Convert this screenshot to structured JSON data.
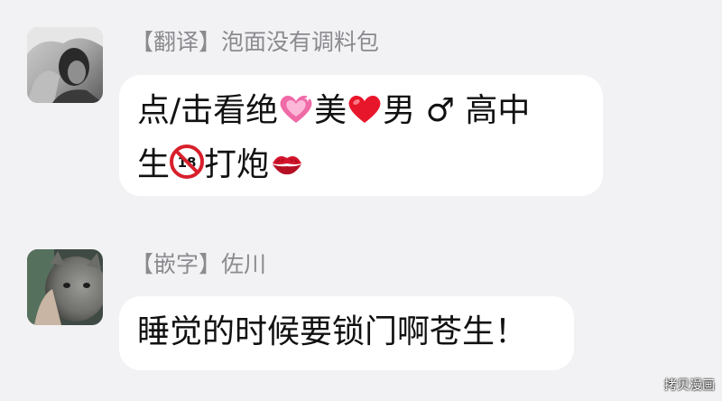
{
  "messages": [
    {
      "sender": "【翻译】泡面没有调料包",
      "text": {
        "line1_a": "点/击看绝",
        "line1_b": "美",
        "line1_c": "男",
        "line1_d": "♂ 高中",
        "line2_a": "生",
        "line2_b": "打炮"
      }
    },
    {
      "sender": "【嵌字】佐川",
      "text": "睡觉的时候要锁门啊苍生！"
    }
  ],
  "icons": {
    "emoji_1": "sparkling-heart-icon",
    "emoji_2": "red-heart-icon",
    "emoji_3": "no-under-18-icon",
    "emoji_4": "kiss-mark-icon"
  },
  "colors": {
    "background": "#f2f2f4",
    "bubble": "#ffffff",
    "sender_text": "#8a8a8f",
    "message_text": "#111111",
    "heart_pink": "#f06aa8",
    "heart_red": "#e8162b"
  },
  "watermark": "拷贝漫画"
}
